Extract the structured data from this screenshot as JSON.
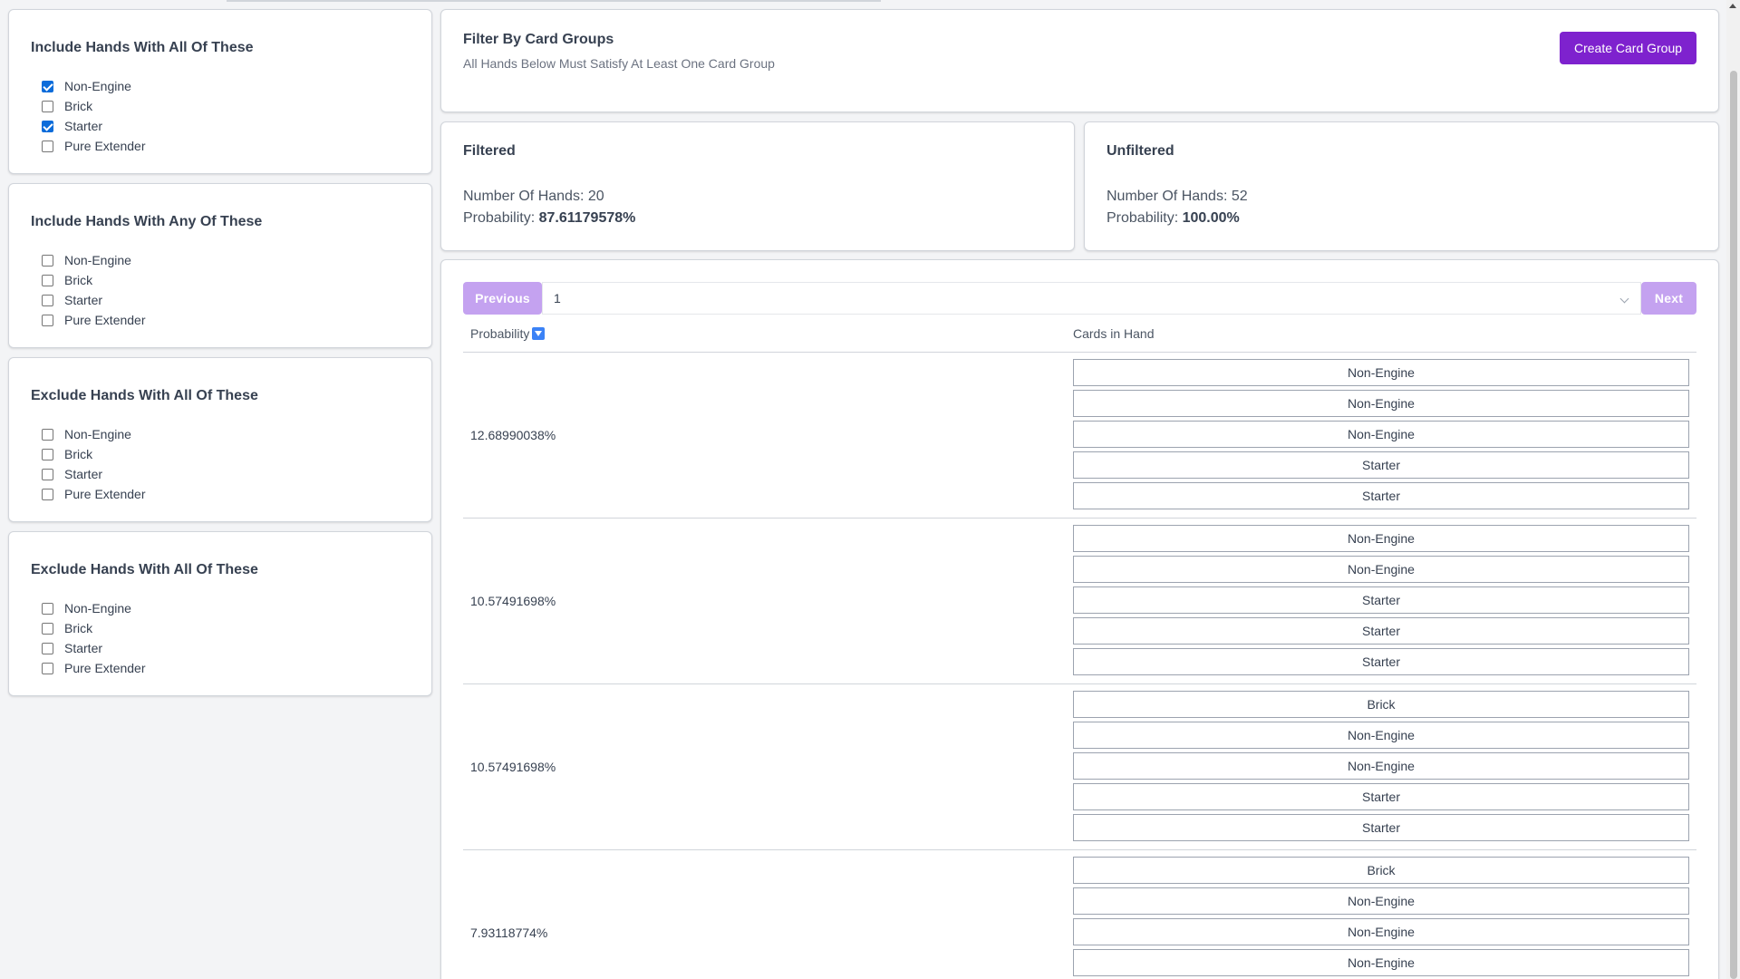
{
  "filters": [
    {
      "title": "Include Hands With All Of These",
      "options": [
        {
          "label": "Non-Engine",
          "checked": true
        },
        {
          "label": "Brick",
          "checked": false
        },
        {
          "label": "Starter",
          "checked": true
        },
        {
          "label": "Pure Extender",
          "checked": false
        }
      ]
    },
    {
      "title": "Include Hands With Any Of These",
      "options": [
        {
          "label": "Non-Engine",
          "checked": false
        },
        {
          "label": "Brick",
          "checked": false
        },
        {
          "label": "Starter",
          "checked": false
        },
        {
          "label": "Pure Extender",
          "checked": false
        }
      ]
    },
    {
      "title": "Exclude Hands With All Of These",
      "options": [
        {
          "label": "Non-Engine",
          "checked": false
        },
        {
          "label": "Brick",
          "checked": false
        },
        {
          "label": "Starter",
          "checked": false
        },
        {
          "label": "Pure Extender",
          "checked": false
        }
      ]
    },
    {
      "title": "Exclude Hands With All Of These",
      "options": [
        {
          "label": "Non-Engine",
          "checked": false
        },
        {
          "label": "Brick",
          "checked": false
        },
        {
          "label": "Starter",
          "checked": false
        },
        {
          "label": "Pure Extender",
          "checked": false
        }
      ]
    }
  ],
  "card_groups": {
    "title": "Filter By Card Groups",
    "subtitle": "All Hands Below Must Satisfy At Least One Card Group",
    "create_label": "Create Card Group"
  },
  "filtered": {
    "title": "Filtered",
    "hands_label": "Number Of Hands: ",
    "hands_value": "20",
    "prob_label": "Probability: ",
    "prob_value": "87.61179578%"
  },
  "unfiltered": {
    "title": "Unfiltered",
    "hands_label": "Number Of Hands: ",
    "hands_value": "52",
    "prob_label": "Probability: ",
    "prob_value": "100.00%"
  },
  "pager": {
    "previous_label": "Previous",
    "page_value": "1",
    "next_label": "Next"
  },
  "table": {
    "col_probability": "Probability",
    "col_cards": "Cards in Hand",
    "rows": [
      {
        "probability": "12.68990038%",
        "cards": [
          "Non-Engine",
          "Non-Engine",
          "Non-Engine",
          "Starter",
          "Starter"
        ]
      },
      {
        "probability": "10.57491698%",
        "cards": [
          "Non-Engine",
          "Non-Engine",
          "Starter",
          "Starter",
          "Starter"
        ]
      },
      {
        "probability": "10.57491698%",
        "cards": [
          "Brick",
          "Non-Engine",
          "Non-Engine",
          "Starter",
          "Starter"
        ]
      },
      {
        "probability": "7.93118774%",
        "cards": [
          "Brick",
          "Non-Engine",
          "Non-Engine",
          "Non-Engine"
        ]
      }
    ]
  },
  "colors": {
    "accent": "#7e22ce",
    "accent_disabled": "#c4a2f0",
    "checkbox": "#0b6cda",
    "sort_icon": "#3b82f6"
  }
}
